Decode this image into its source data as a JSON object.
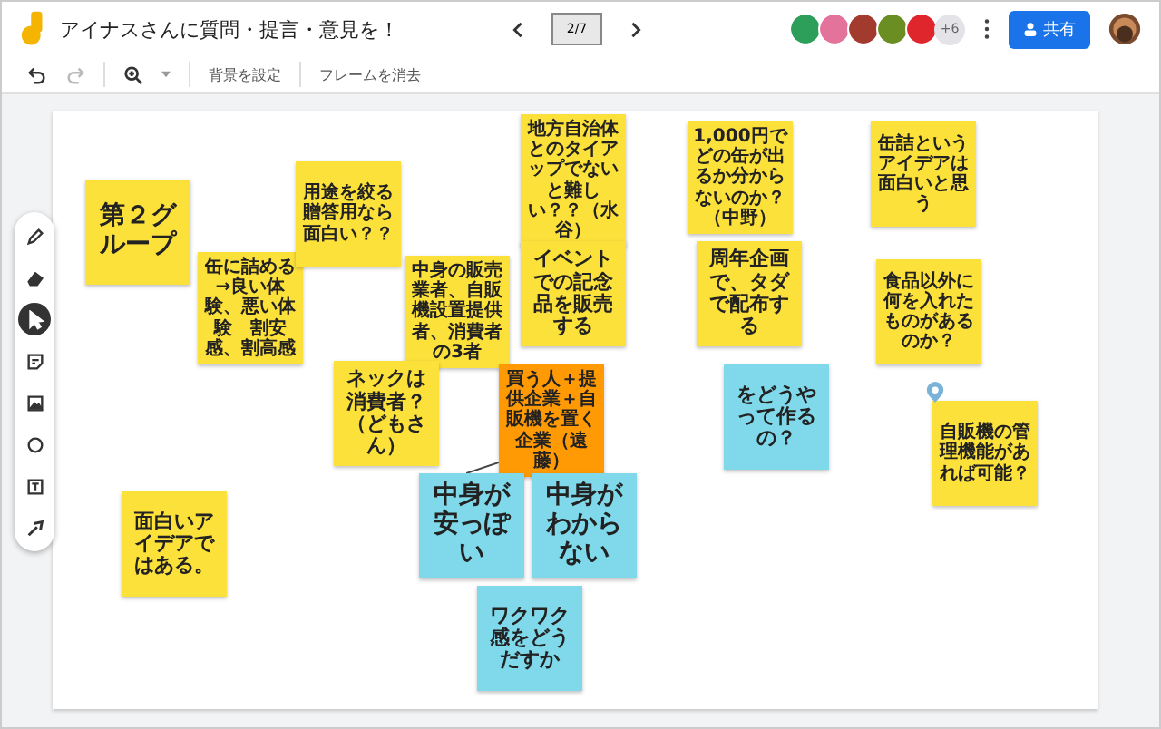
{
  "window": {
    "title": "アイナスさんに質問・提言・意見を！"
  },
  "frame_indicator": "2/7",
  "collaborators": [
    {
      "color": "#2e9e5b"
    },
    {
      "color": "#e3739b"
    },
    {
      "color": "#a33a2e"
    },
    {
      "color": "#6b8e23"
    },
    {
      "color": "#e0262d"
    }
  ],
  "more_collaborators": "+6",
  "share_button": "共有",
  "toolbar": {
    "background_button": "背景を設定",
    "clear_frame_button": "フレームを消去"
  },
  "tools": [
    {
      "kind": "pen",
      "selected": false
    },
    {
      "kind": "eraser",
      "selected": false
    },
    {
      "kind": "select",
      "selected": true
    },
    {
      "kind": "note",
      "selected": false
    },
    {
      "kind": "image",
      "selected": false
    },
    {
      "kind": "circle",
      "selected": false
    },
    {
      "kind": "textbox",
      "selected": false
    },
    {
      "kind": "laser",
      "selected": false
    }
  ],
  "notes": [
    {
      "text": "第２グループ",
      "color": "#fde13b"
    },
    {
      "text": "缶に詰める　→良い体験、悪い体験　割安感、割高感",
      "color": "#fde13b"
    },
    {
      "text": "用途を絞る贈答用なら面白い？？",
      "color": "#fde13b"
    },
    {
      "text": "地方自治体とのタイアップでないと難しい？？（水谷）",
      "color": "#fde13b"
    },
    {
      "text": "1,000円でどの缶が出るか分からないのか？（中野）",
      "color": "#fde13b"
    },
    {
      "text": "缶詰というアイデアは面白いと思う",
      "color": "#fde13b"
    },
    {
      "text": "中身の販売業者、自販機設置提供者、消費者の3者",
      "color": "#fde13b"
    },
    {
      "text": "イベントでの記念品を販売する",
      "color": "#fde13b"
    },
    {
      "text": "周年企画で、タダで配布する",
      "color": "#fde13b"
    },
    {
      "text": "をどうやって作るの？",
      "color": "#7fd9ea"
    },
    {
      "text": "食品以外に何を入れたものがあるのか？",
      "color": "#fde13b"
    },
    {
      "text": "ネックは消費者？（どもさん）",
      "color": "#fde13b"
    },
    {
      "text": "買う人＋提供企業＋自販機を置く企業（遠藤）",
      "color": "#ff9a05"
    },
    {
      "text": "中身が安っぽい",
      "color": "#7fd9ea"
    },
    {
      "text": "中身がわからない",
      "color": "#7fd9ea"
    },
    {
      "text": "ワクワク感をどうだすか",
      "color": "#7fd9ea"
    },
    {
      "text": "自販機の管理機能があれば可能？",
      "color": "#fde13b"
    },
    {
      "text": "面白いアイデアではある。",
      "color": "#fde13b"
    }
  ]
}
